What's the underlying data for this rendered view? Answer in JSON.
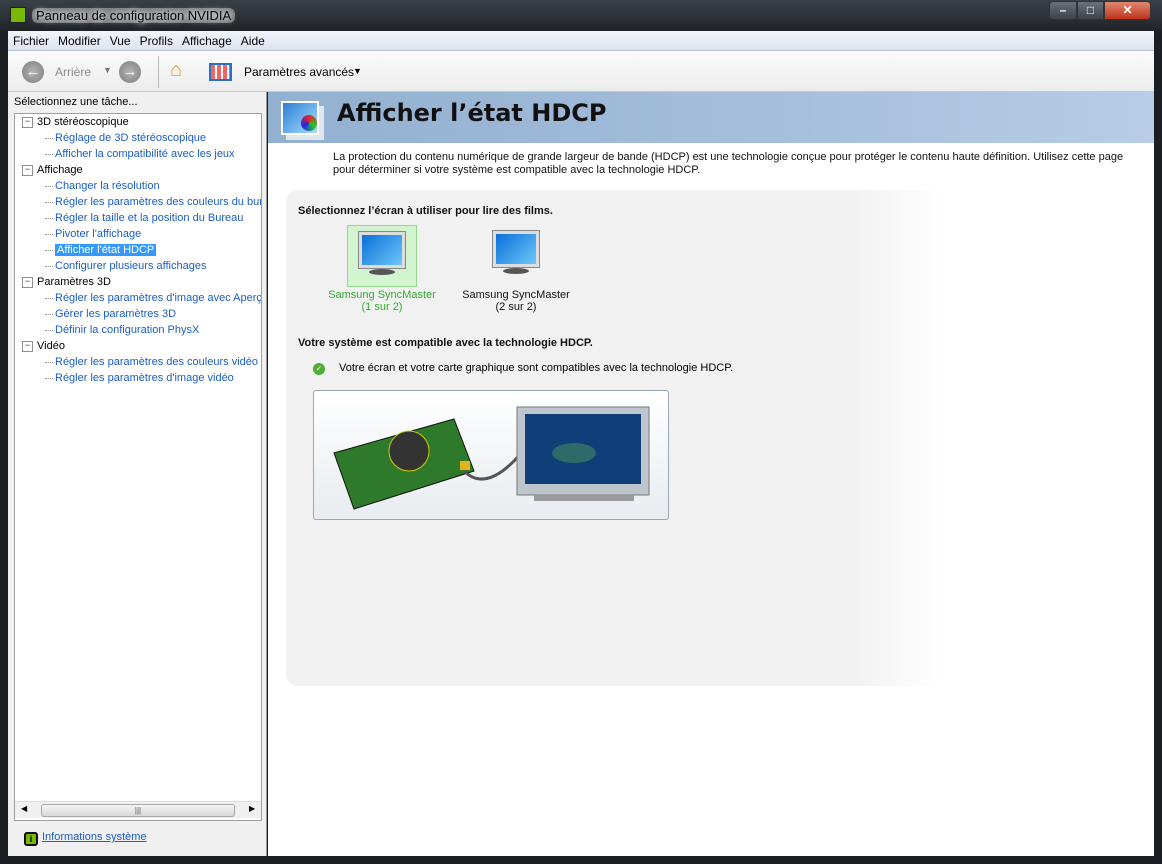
{
  "window": {
    "title": "Panneau de configuration NVIDIA",
    "controls": [
      "minimize",
      "maximize",
      "close"
    ]
  },
  "menu": [
    "Fichier",
    "Modifier",
    "Vue",
    "Profils",
    "Affichage",
    "Aide"
  ],
  "toolbar": {
    "back_label": "Arrière",
    "advanced_label": "Paramètres avancés"
  },
  "sidebar": {
    "heading": "Sélectionnez une tâche...",
    "tree": [
      {
        "label": "3D stéréoscopique",
        "items": [
          "Réglage de 3D stéréoscopique",
          "Afficher la compatibilité avec les jeux"
        ]
      },
      {
        "label": "Affichage",
        "items": [
          "Changer la résolution",
          "Régler les paramètres des couleurs du bureau",
          "Régler la taille et la position du Bureau",
          "Pivoter l'affichage",
          "Afficher l'état HDCP",
          "Configurer plusieurs affichages"
        ]
      },
      {
        "label": "Paramètres 3D",
        "items": [
          "Régler les paramètres d'image avec Aperçu",
          "Gérer les paramètres 3D",
          "Définir la configuration PhysX"
        ]
      },
      {
        "label": "Vidéo",
        "items": [
          "Régler les paramètres des couleurs vidéo",
          "Régler les paramètres d'image vidéo"
        ]
      }
    ],
    "selected": "Afficher l'état HDCP",
    "system_info": "Informations système"
  },
  "main": {
    "title": "Afficher l’état HDCP",
    "description": "La protection du contenu numérique de grande largeur de bande (HDCP) est une technologie conçue pour protéger le contenu haute définition. Utilisez cette page pour déterminer si votre système est compatible avec la technologie HDCP.",
    "select_heading": "Sélectionnez l’écran à utiliser pour lire des films.",
    "monitors": [
      {
        "name": "Samsung SyncMaster",
        "index": "(1 sur 2)",
        "selected": true
      },
      {
        "name": "Samsung SyncMaster",
        "index": "(2 sur 2)",
        "selected": false
      }
    ],
    "status_heading": "Votre système est compatible avec la technologie HDCP.",
    "status_text": "Votre écran et votre carte graphique sont compatibles avec la technologie HDCP."
  },
  "colors": {
    "accent": "#76b900",
    "link": "#1b5ec7",
    "selected": "#3399ff",
    "header": "#9db6d3"
  }
}
